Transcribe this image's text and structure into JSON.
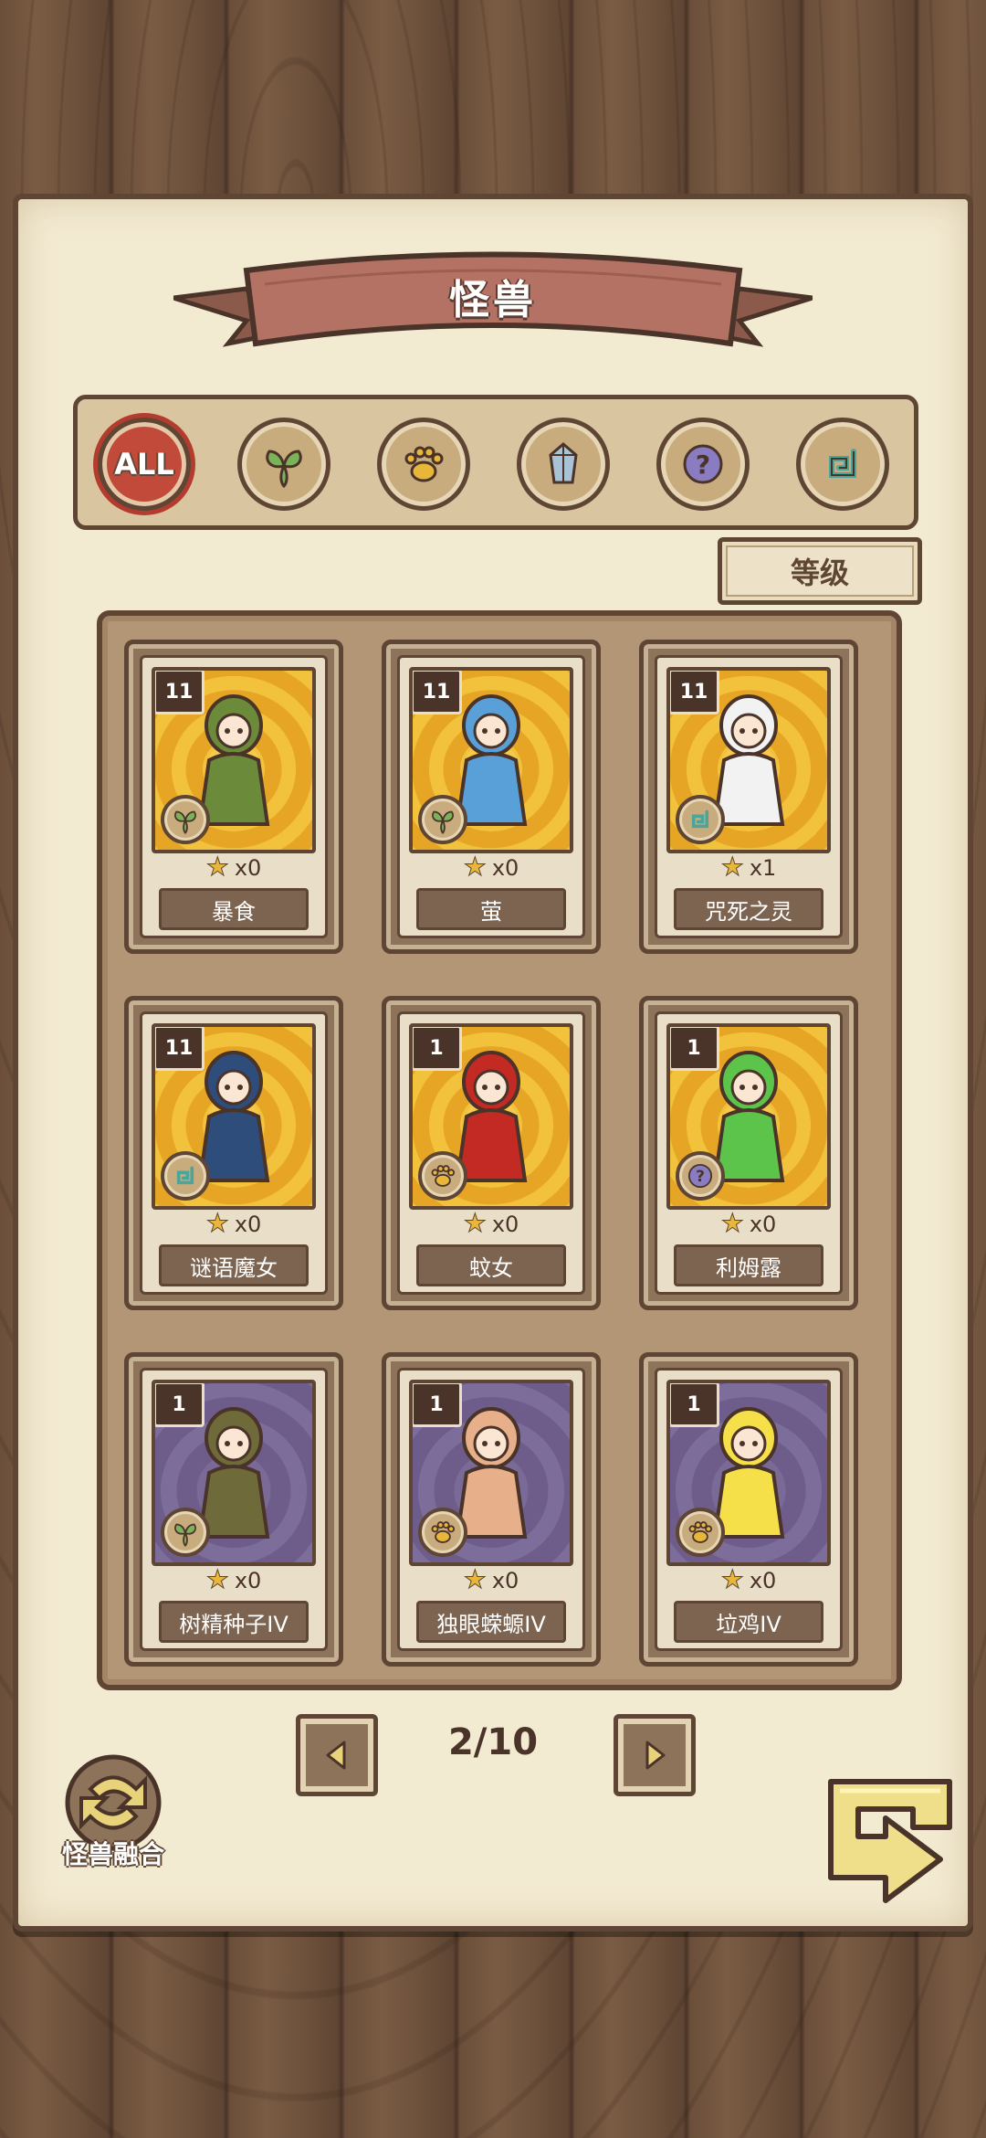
{
  "header": {
    "title": "怪兽"
  },
  "filters": [
    {
      "label": "ALL",
      "icon": "all-icon",
      "active": true
    },
    {
      "label": "",
      "icon": "leaf-icon",
      "active": false
    },
    {
      "label": "",
      "icon": "paw-icon",
      "active": false
    },
    {
      "label": "",
      "icon": "crystal-icon",
      "active": false
    },
    {
      "label": "",
      "icon": "question-icon",
      "active": false
    },
    {
      "label": "",
      "icon": "swirl-icon",
      "active": false
    }
  ],
  "sort": {
    "label": "等级"
  },
  "cards": [
    {
      "level": "11",
      "name": "暴食",
      "count": "x0",
      "bg": "gold",
      "type": "leaf-icon",
      "figure_color": "#6b8a3a"
    },
    {
      "level": "11",
      "name": "萤",
      "count": "x0",
      "bg": "gold",
      "type": "leaf-icon",
      "figure_color": "#5aa0d8"
    },
    {
      "level": "11",
      "name": "咒死之灵",
      "count": "x1",
      "bg": "gold",
      "type": "swirl-icon",
      "figure_color": "#f2f2f2"
    },
    {
      "level": "11",
      "name": "谜语魔女",
      "count": "x0",
      "bg": "gold",
      "type": "swirl-icon",
      "figure_color": "#2f4d7a"
    },
    {
      "level": "1",
      "name": "蚊女",
      "count": "x0",
      "bg": "gold",
      "type": "paw-icon",
      "figure_color": "#c42a24"
    },
    {
      "level": "1",
      "name": "利姆露",
      "count": "x0",
      "bg": "gold",
      "type": "question-icon",
      "figure_color": "#5cc44a"
    },
    {
      "level": "1",
      "name": "树精种子IV",
      "count": "x0",
      "bg": "purple",
      "type": "leaf-icon",
      "figure_color": "#6e6a3a"
    },
    {
      "level": "1",
      "name": "独眼蝾螈IV",
      "count": "x0",
      "bg": "purple",
      "type": "paw-icon",
      "figure_color": "#e7b08a"
    },
    {
      "level": "1",
      "name": "垃鸡IV",
      "count": "x0",
      "bg": "purple",
      "type": "paw-icon",
      "figure_color": "#f6e04a"
    }
  ],
  "pager": {
    "text": "2/10"
  },
  "fusion": {
    "label": "怪兽融合"
  },
  "colors": {
    "accent_red": "#c24a3b",
    "wood_dark": "#5e4534",
    "paper": "#f3ead2"
  }
}
